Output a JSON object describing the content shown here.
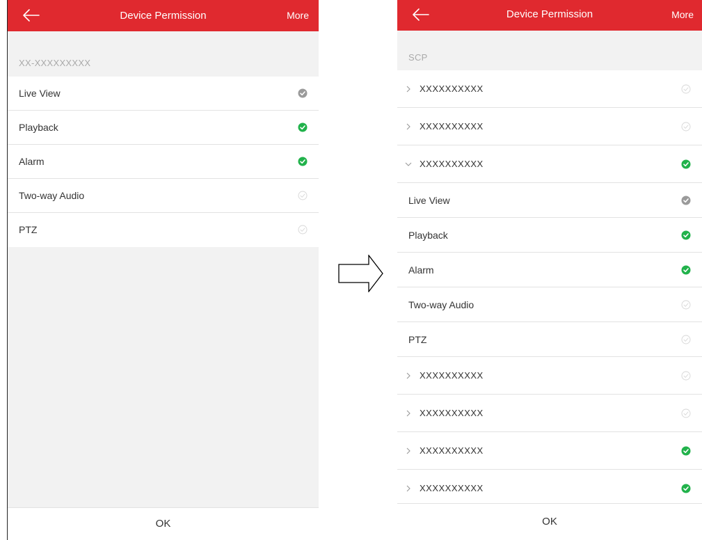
{
  "header": {
    "title": "Device Permission",
    "more_label": "More",
    "back_icon": "arrow-left-icon"
  },
  "colors": {
    "brand_red": "#e0292f",
    "check_green": "#21b24b",
    "check_gray": "#9a9a9a",
    "check_light": "#d6d6d6"
  },
  "left_panel": {
    "device_name": "XX-XXXXXXXXX",
    "permissions": [
      {
        "label": "Live View",
        "state": "gray"
      },
      {
        "label": "Playback",
        "state": "green"
      },
      {
        "label": "Alarm",
        "state": "green"
      },
      {
        "label": "Two-way Audio",
        "state": "empty"
      },
      {
        "label": "PTZ",
        "state": "empty"
      }
    ],
    "ok_label": "OK"
  },
  "right_panel": {
    "section_label": "SCP",
    "items": [
      {
        "kind": "group",
        "label": "XXXXXXXXXX",
        "expanded": false,
        "state": "empty"
      },
      {
        "kind": "group",
        "label": "XXXXXXXXXX",
        "expanded": false,
        "state": "empty"
      },
      {
        "kind": "group",
        "label": "XXXXXXXXXX",
        "expanded": true,
        "state": "green"
      },
      {
        "kind": "perm",
        "label": "Live View",
        "state": "gray"
      },
      {
        "kind": "perm",
        "label": "Playback",
        "state": "green"
      },
      {
        "kind": "perm",
        "label": "Alarm",
        "state": "green"
      },
      {
        "kind": "perm",
        "label": "Two-way Audio",
        "state": "empty"
      },
      {
        "kind": "perm",
        "label": "PTZ",
        "state": "empty"
      },
      {
        "kind": "group",
        "label": "XXXXXXXXXX",
        "expanded": false,
        "state": "empty"
      },
      {
        "kind": "group",
        "label": "XXXXXXXXXX",
        "expanded": false,
        "state": "empty"
      },
      {
        "kind": "group",
        "label": "XXXXXXXXXX",
        "expanded": false,
        "state": "green"
      },
      {
        "kind": "group",
        "label": "XXXXXXXXXX",
        "expanded": false,
        "state": "green"
      }
    ],
    "ok_label": "OK"
  },
  "transition_icon": "right-arrow-outline-icon"
}
